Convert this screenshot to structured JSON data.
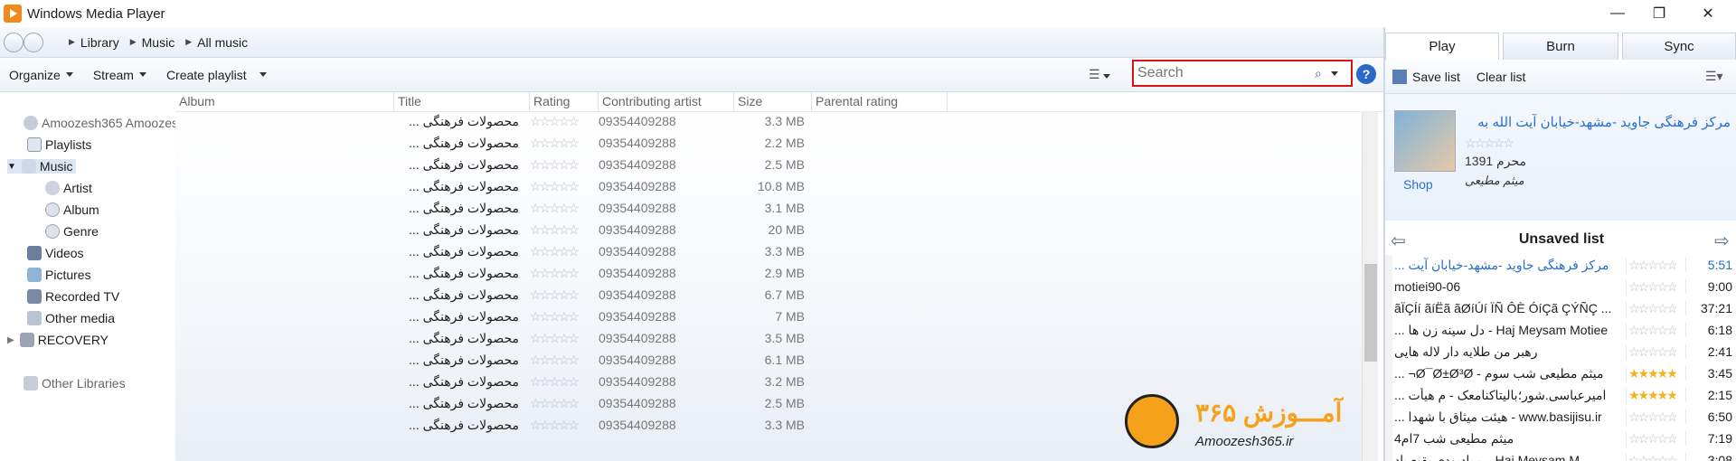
{
  "window": {
    "title": "Windows Media Player",
    "min": "—",
    "max": "❐",
    "close": "✕"
  },
  "breadcrumb": [
    "Library",
    "Music",
    "All music"
  ],
  "toolbar": {
    "organize": "Organize",
    "stream": "Stream",
    "create_playlist": "Create playlist",
    "search_placeholder": "Search",
    "help": "?"
  },
  "sidebar": {
    "items": [
      {
        "label": "Amoozesh365 Amoozesh"
      },
      {
        "label": "Playlists"
      },
      {
        "label": "Music"
      },
      {
        "label": "Artist"
      },
      {
        "label": "Album"
      },
      {
        "label": "Genre"
      },
      {
        "label": "Videos"
      },
      {
        "label": "Pictures"
      },
      {
        "label": "Recorded TV"
      },
      {
        "label": "Other media"
      },
      {
        "label": "RECOVERY"
      },
      {
        "label": "Other Libraries"
      }
    ]
  },
  "columns": [
    "Album",
    "Title",
    "Rating",
    "Contributing artist",
    "Size",
    "Parental rating"
  ],
  "rows": [
    {
      "title": "محصولات فرهنگی ...",
      "rating": "☆☆☆☆☆",
      "artist": "09354409288",
      "size": "3.3 MB"
    },
    {
      "title": "محصولات فرهنگی ...",
      "rating": "☆☆☆☆☆",
      "artist": "09354409288",
      "size": "2.2 MB"
    },
    {
      "title": "محصولات فرهنگی ...",
      "rating": "☆☆☆☆☆",
      "artist": "09354409288",
      "size": "2.5 MB"
    },
    {
      "title": "محصولات فرهنگی ...",
      "rating": "☆☆☆☆☆",
      "artist": "09354409288",
      "size": "10.8 MB"
    },
    {
      "title": "محصولات فرهنگی ...",
      "rating": "☆☆☆☆☆",
      "artist": "09354409288",
      "size": "3.1 MB"
    },
    {
      "title": "محصولات فرهنگی ...",
      "rating": "☆☆☆☆☆",
      "artist": "09354409288",
      "size": "20 MB"
    },
    {
      "title": "محصولات فرهنگی ...",
      "rating": "☆☆☆☆☆",
      "artist": "09354409288",
      "size": "3.3 MB"
    },
    {
      "title": "محصولات فرهنگی ...",
      "rating": "☆☆☆☆☆",
      "artist": "09354409288",
      "size": "2.9 MB"
    },
    {
      "title": "محصولات فرهنگی ...",
      "rating": "☆☆☆☆☆",
      "artist": "09354409288",
      "size": "6.7 MB"
    },
    {
      "title": "محصولات فرهنگی ...",
      "rating": "☆☆☆☆☆",
      "artist": "09354409288",
      "size": "7 MB"
    },
    {
      "title": "محصولات فرهنگی ...",
      "rating": "☆☆☆☆☆",
      "artist": "09354409288",
      "size": "3.5 MB"
    },
    {
      "title": "محصولات فرهنگی ...",
      "rating": "☆☆☆☆☆",
      "artist": "09354409288",
      "size": "6.1 MB"
    },
    {
      "title": "محصولات فرهنگی ...",
      "rating": "☆☆☆☆☆",
      "artist": "09354409288",
      "size": "3.2 MB"
    },
    {
      "title": "محصولات فرهنگی ...",
      "rating": "☆☆☆☆☆",
      "artist": "09354409288",
      "size": "2.5 MB"
    },
    {
      "title": "محصولات فرهنگی ...",
      "rating": "☆☆☆☆☆",
      "artist": "09354409288",
      "size": "3.3 MB"
    }
  ],
  "right": {
    "tabs": [
      "Play",
      "Burn",
      "Sync"
    ],
    "save_list": "Save list",
    "clear_list": "Clear list",
    "now_playing": {
      "title": "مرکز فرهنگی جاوید -مشهد-خیابان آیت الله به",
      "stars": "☆☆☆☆☆",
      "year": "محرم 1391",
      "artist": "میثم مطیعی",
      "shop": "Shop"
    },
    "list_title": "Unsaved list",
    "playlist": [
      {
        "title": "مرکز فرهنگی جاوید -مشهد-خیابان آیت ...",
        "stars": "☆☆☆☆☆",
        "dur": "5:51",
        "gold": false,
        "current": true
      },
      {
        "title": "motiei90-06",
        "stars": "☆☆☆☆☆",
        "dur": "9:00",
        "gold": false
      },
      {
        "title": "ãÏÇÍí ãíËã ãØíÚí ÏÑ ÔÈ ÓíÇã ÇÝÑÇ ...",
        "stars": "☆☆☆☆☆",
        "dur": "37:21",
        "gold": false
      },
      {
        "title": "Haj Meysam Motiee - دل سینه زن ها ...",
        "stars": "☆☆☆☆☆",
        "dur": "6:18",
        "gold": false
      },
      {
        "title": "رهبر من طلایه دار لاله هایی",
        "stars": "☆☆☆☆☆",
        "dur": "2:41",
        "gold": false
      },
      {
        "title": "میثم مطیعی شب سوم - Ø¯Ø±Ø³Ø¬ ...",
        "stars": "★★★★★",
        "dur": "3:45",
        "gold": true
      },
      {
        "title": "امیرعباسی.شور؛بالیتاکنامعک - م هیأت ...",
        "stars": "★★★★★",
        "dur": "2:15",
        "gold": true
      },
      {
        "title": "www.basijisu.ir - هیئت میثاق با شهدا ...",
        "stars": "☆☆☆☆☆",
        "dur": "6:50",
        "gold": false
      },
      {
        "title": "میثم مطیعی شب 7ام4",
        "stars": "☆☆☆☆☆",
        "dur": "7:19",
        "gold": false
      },
      {
        "title": "Haj Meysam M... - یادبودی بقیع یاد",
        "stars": "☆☆☆☆☆",
        "dur": "3:08",
        "gold": false
      }
    ]
  },
  "watermark": {
    "logo_text": "آمـــوزش ۳۶۵",
    "url": "Amoozesh365.ir"
  }
}
